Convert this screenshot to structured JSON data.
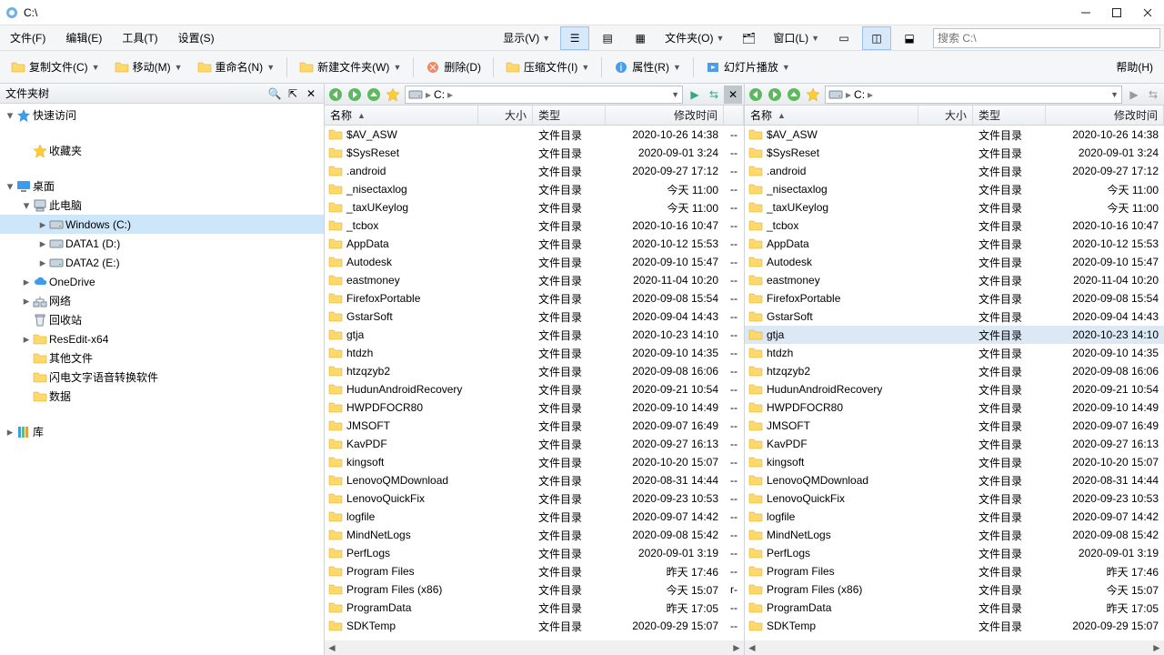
{
  "title": "C:\\",
  "menus": [
    "文件(F)",
    "编辑(E)",
    "工具(T)",
    "设置(S)"
  ],
  "view_label": "显示(V)",
  "folder_label": "文件夹(O)",
  "window_label": "窗口(L)",
  "help_label": "帮助(H)",
  "search_placeholder": "搜索 C:\\",
  "toolbar": {
    "copy": "复制文件(C)",
    "move": "移动(M)",
    "rename": "重命名(N)",
    "newfolder": "新建文件夹(W)",
    "delete": "删除(D)",
    "compress": "压缩文件(I)",
    "props": "属性(R)",
    "slideshow": "幻灯片播放"
  },
  "tree_header": "文件夹树",
  "tree": [
    {
      "d": 0,
      "tw": "▾",
      "icon": "star-blue",
      "label": "快速访问"
    },
    {
      "d": 1,
      "tw": "",
      "icon": "star-yellow",
      "label": "收藏夹",
      "gap": true
    },
    {
      "d": 0,
      "tw": "▾",
      "icon": "desktop",
      "label": "桌面",
      "mt": true
    },
    {
      "d": 1,
      "tw": "▾",
      "icon": "pc",
      "label": "此电脑"
    },
    {
      "d": 2,
      "tw": "▸",
      "icon": "drive",
      "label": "Windows (C:)",
      "sel": true
    },
    {
      "d": 2,
      "tw": "▸",
      "icon": "drive",
      "label": "DATA1 (D:)"
    },
    {
      "d": 2,
      "tw": "▸",
      "icon": "drive",
      "label": "DATA2 (E:)"
    },
    {
      "d": 1,
      "tw": "▸",
      "icon": "cloud",
      "label": "OneDrive"
    },
    {
      "d": 1,
      "tw": "▸",
      "icon": "net",
      "label": "网络"
    },
    {
      "d": 1,
      "tw": "",
      "icon": "bin",
      "label": "回收站"
    },
    {
      "d": 1,
      "tw": "▸",
      "icon": "folder",
      "label": "ResEdit-x64"
    },
    {
      "d": 1,
      "tw": "",
      "icon": "folder",
      "label": "其他文件"
    },
    {
      "d": 1,
      "tw": "",
      "icon": "folder",
      "label": "闪电文字语音转换软件"
    },
    {
      "d": 1,
      "tw": "",
      "icon": "folder",
      "label": "数据"
    },
    {
      "d": 0,
      "tw": "▸",
      "icon": "lib",
      "label": "库",
      "mt": true
    }
  ],
  "crumb_text": "C:",
  "columns": {
    "name": "名称",
    "size": "大小",
    "type": "类型",
    "date": "修改时间"
  },
  "type_label": "文件目录",
  "files": [
    {
      "n": "$AV_ASW",
      "d": "2020-10-26  14:38",
      "a": "--"
    },
    {
      "n": "$SysReset",
      "d": "2020-09-01    3:24",
      "a": "--"
    },
    {
      "n": ".android",
      "d": "2020-09-27  17:12",
      "a": "--"
    },
    {
      "n": "_nisectaxlog",
      "d": "今天  11:00",
      "a": "--"
    },
    {
      "n": "_taxUKeylog",
      "d": "今天  11:00",
      "a": "--"
    },
    {
      "n": "_tcbox",
      "d": "2020-10-16  10:47",
      "a": "--"
    },
    {
      "n": "AppData",
      "d": "2020-10-12  15:53",
      "a": "--"
    },
    {
      "n": "Autodesk",
      "d": "2020-09-10  15:47",
      "a": "--"
    },
    {
      "n": "eastmoney",
      "d": "2020-11-04  10:20",
      "a": "--"
    },
    {
      "n": "FirefoxPortable",
      "d": "2020-09-08  15:54",
      "a": "--"
    },
    {
      "n": "GstarSoft",
      "d": "2020-09-04  14:43",
      "a": "--"
    },
    {
      "n": "gtja",
      "d": "2020-10-23  14:10",
      "a": "--"
    },
    {
      "n": "htdzh",
      "d": "2020-09-10  14:35",
      "a": "--"
    },
    {
      "n": "htzqzyb2",
      "d": "2020-09-08  16:06",
      "a": "--"
    },
    {
      "n": "HudunAndroidRecovery",
      "d": "2020-09-21  10:54",
      "a": "--"
    },
    {
      "n": "HWPDFOCR80",
      "d": "2020-09-10  14:49",
      "a": "--"
    },
    {
      "n": "JMSOFT",
      "d": "2020-09-07  16:49",
      "a": "--"
    },
    {
      "n": "KavPDF",
      "d": "2020-09-27  16:13",
      "a": "--"
    },
    {
      "n": "kingsoft",
      "d": "2020-10-20  15:07",
      "a": "--"
    },
    {
      "n": "LenovoQMDownload",
      "d": "2020-08-31  14:44",
      "a": "--"
    },
    {
      "n": "LenovoQuickFix",
      "d": "2020-09-23  10:53",
      "a": "--"
    },
    {
      "n": "logfile",
      "d": "2020-09-07  14:42",
      "a": "--"
    },
    {
      "n": "MindNetLogs",
      "d": "2020-09-08  15:42",
      "a": "--"
    },
    {
      "n": "PerfLogs",
      "d": "2020-09-01    3:19",
      "a": "--"
    },
    {
      "n": "Program Files",
      "d": "昨天  17:46",
      "a": "--"
    },
    {
      "n": "Program Files (x86)",
      "d": "今天  15:07",
      "a": "r-"
    },
    {
      "n": "ProgramData",
      "d": "昨天  17:05",
      "a": "--"
    },
    {
      "n": "SDKTemp",
      "d": "2020-09-29  15:07",
      "a": "--"
    }
  ],
  "right_sel_index": 11
}
